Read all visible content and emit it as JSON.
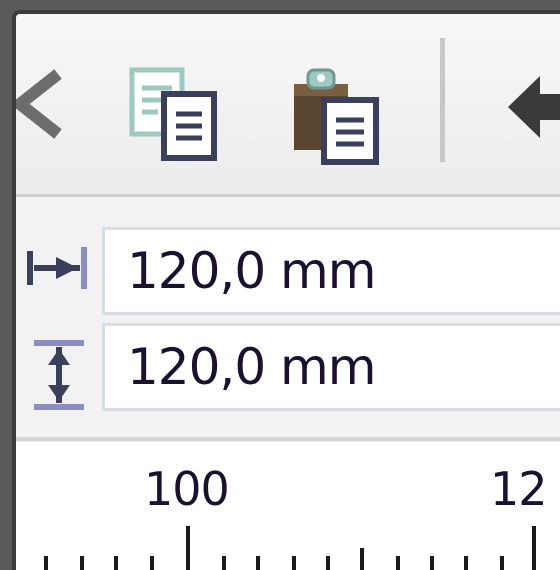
{
  "toolbar": {
    "buttons": [
      {
        "name": "back-icon"
      },
      {
        "name": "copy-attributes-icon"
      },
      {
        "name": "paste-attributes-icon"
      },
      {
        "name": "previous-icon"
      }
    ]
  },
  "properties": {
    "width_value": "120,0 mm",
    "height_value": "120,0 mm"
  },
  "ruler": {
    "labels": [
      "100",
      "12"
    ]
  },
  "colors": {
    "frame": "#3c3c3c",
    "field_border": "#d9dde5",
    "icon_dark": "#3a3f5c",
    "icon_teal": "#9cc9c0",
    "clipboard_brown": "#5a4530"
  }
}
